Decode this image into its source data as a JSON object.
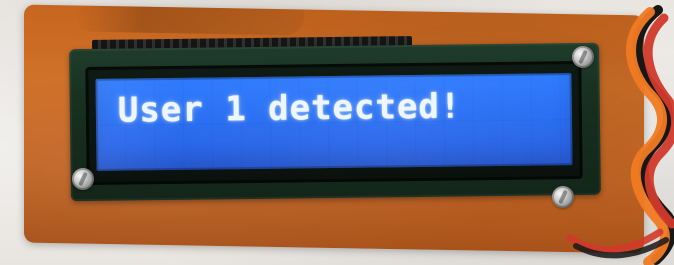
{
  "scene": {
    "lcd_text": "User 1 detected!"
  },
  "colors": {
    "pcb": "#c7661f",
    "lcd_bezel": "#1f3c2b",
    "lcd_backlight": "#2f7cff",
    "lcd_text": "#eef6ff",
    "wire_red": "#d23a2b",
    "wire_orange": "#f07a22",
    "wire_black": "#171717"
  },
  "icons": {
    "screws": "screw-icon",
    "wires": "wire-bundle-icon"
  }
}
